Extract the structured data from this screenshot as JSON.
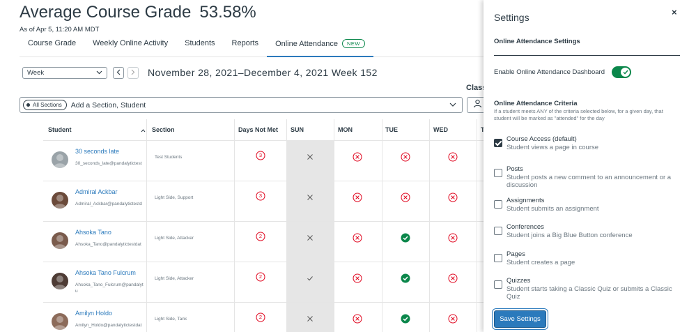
{
  "header": {
    "title": "Average Course Grade",
    "grade": "53.58%",
    "as_of": "As of Apr 5, 11:20 AM MDT"
  },
  "tabs": [
    {
      "label": "Course Grade"
    },
    {
      "label": "Weekly Online Activity"
    },
    {
      "label": "Students"
    },
    {
      "label": "Reports"
    },
    {
      "label": "Online Attendance",
      "badge": "NEW",
      "active": true
    }
  ],
  "toolbar": {
    "period_select": "Week",
    "week_range": "November 28, 2021–December 4, 2021 Week 152",
    "class_label": "Class"
  },
  "filter": {
    "pill": "All Sections",
    "placeholder": "Add a Section, Student"
  },
  "table": {
    "headers": [
      "Student",
      "Section",
      "Days Not Met",
      "SUN",
      "MON",
      "TUE",
      "WED",
      "T"
    ],
    "rows": [
      {
        "name": "30 seconds late",
        "email": "30_seconds_late@pandalytictest",
        "section": "Test Students",
        "days_not_met": "3",
        "sun": "x",
        "mon": "miss",
        "tue": "miss",
        "wed": "miss"
      },
      {
        "name": "Admiral Ackbar",
        "email": "Admiral_Ackbar@pandalytictestd",
        "section": "Light Side, Support",
        "days_not_met": "3",
        "sun": "x",
        "mon": "miss",
        "tue": "miss",
        "wed": "miss"
      },
      {
        "name": "Ahsoka Tano",
        "email": "Ahsoka_Tano@pandalytictestdat",
        "section": "Light Side, Attacker",
        "days_not_met": "2",
        "sun": "x",
        "mon": "miss",
        "tue": "met",
        "wed": "miss"
      },
      {
        "name": "Ahsoka Tano Fulcrum",
        "email": "Ahsoka_Tano_Fulcrum@pandalyt",
        "email_wrap": "u",
        "section": "Light Side, Attacker",
        "days_not_met": "2",
        "sun": "check",
        "mon": "miss",
        "tue": "met",
        "wed": "miss"
      },
      {
        "name": "Amilyn Holdo",
        "email": "Amilyn_Holdo@pandalytictestdat",
        "section": "Light Side, Tank",
        "days_not_met": "2",
        "sun": "x",
        "mon": "miss",
        "tue": "met",
        "wed": "miss"
      }
    ]
  },
  "settings": {
    "title": "Settings",
    "close": "×",
    "subtitle": "Online Attendance Settings",
    "enable_label": "Enable Online Attendance Dashboard",
    "enabled": true,
    "criteria_title": "Online Attendance Criteria",
    "criteria_desc": "If a student meets ANY of the criteria selected below, for a given day, that student will be marked as \"attended\" for the day",
    "criteria": [
      {
        "label": "Course Access (default)",
        "help": "Student views a page in course",
        "checked": true
      },
      {
        "label": "Posts",
        "help": "Student posts a new comment to an announcement or a discussion",
        "checked": false
      },
      {
        "label": "Assignments",
        "help": "Student submits an assignment",
        "checked": false
      },
      {
        "label": "Conferences",
        "help": "Student joins a Big Blue Button conference",
        "checked": false
      },
      {
        "label": "Pages",
        "help": "Student creates a page",
        "checked": false
      },
      {
        "label": "Quizzes",
        "help": "Student starts taking a Classic Quiz or submits a Classic Quiz",
        "checked": false
      }
    ],
    "save_label": "Save Settings"
  },
  "colors": {
    "accent": "#2b7abc",
    "miss": "#e0061f",
    "met": "#0b874b"
  }
}
